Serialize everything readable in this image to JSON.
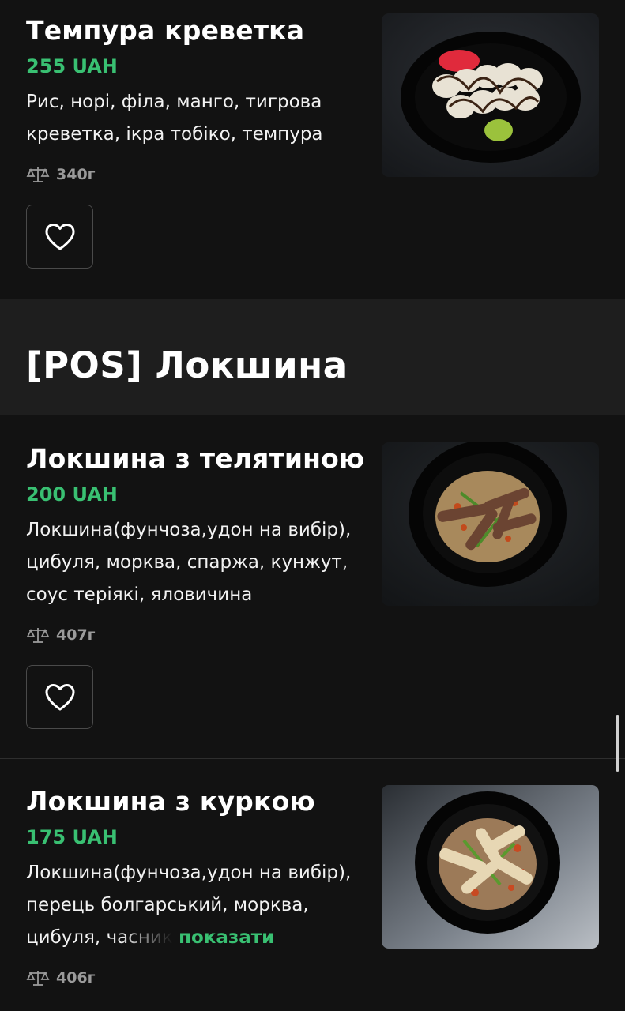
{
  "items": [
    {
      "title": "Темпура креветка",
      "price": "255 UAH",
      "description": "Рис, норі, філа,  манго, тигрова креветка, ікра тобіко, темпура",
      "weight": "340г"
    },
    {
      "title": "Локшина з телятиною",
      "price": "200 UAH",
      "description": "Локшина(фунчоза,удон на вибір), цибуля, морква, спаржа, кунжут, соус теріякі, яловичина",
      "weight": "407г"
    },
    {
      "title": "Локшина з куркою",
      "price": "175 UAH",
      "description_visible": "Локшина(фунчоза,удон на вибір), перець болгарський, морква, цибуля, ",
      "description_faded": "часник",
      "show_more": "показати",
      "weight": "406г"
    }
  ],
  "section": {
    "title": "[POS] Локшина"
  },
  "icons": {
    "weight": "scale-icon",
    "favorite": "heart-icon"
  },
  "colors": {
    "background": "#121212",
    "accent": "#39c072",
    "section_bg": "#1e1e1e"
  }
}
